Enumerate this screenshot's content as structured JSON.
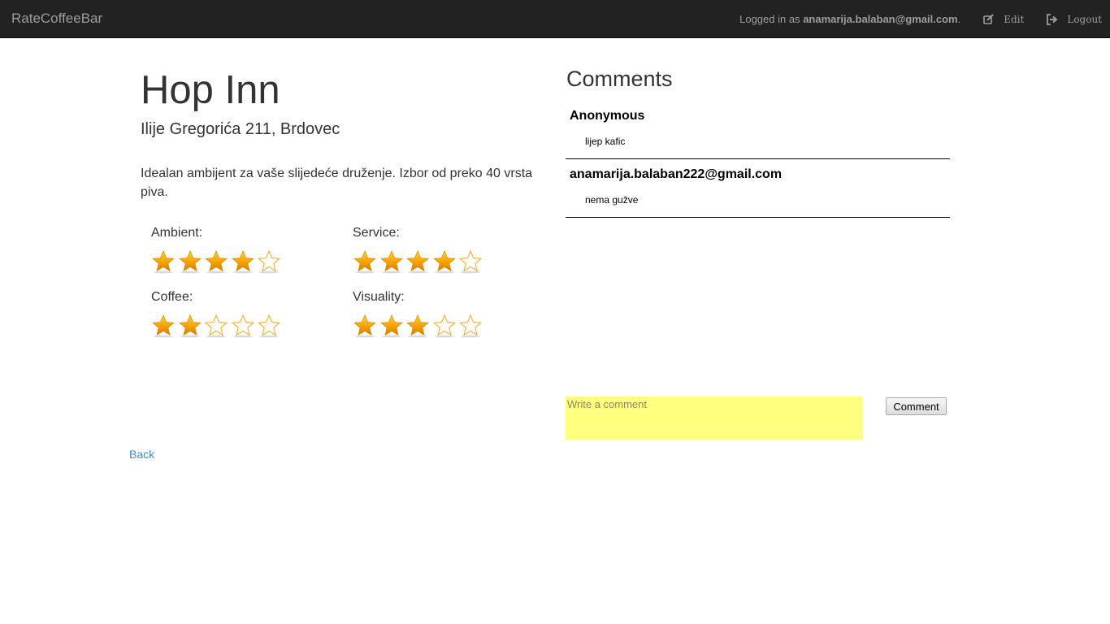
{
  "navbar": {
    "brand": "RateCoffeeBar",
    "logged_in_prefix": "Logged in as ",
    "user_email": "anamarija.balaban@gmail.com",
    "logged_in_suffix": ".",
    "edit_label": "Edit",
    "logout_label": "Logout"
  },
  "place": {
    "name": "Hop Inn",
    "address": "Ilije Gregorića 211, Brdovec",
    "description": "Idealan ambijent za vaše slijedeće druženje. Izbor od preko 40 vrsta piva."
  },
  "ratings": [
    {
      "label": "Ambient:",
      "value": 4,
      "max": 5
    },
    {
      "label": "Service:",
      "value": 4,
      "max": 5
    },
    {
      "label": "Coffee:",
      "value": 2,
      "max": 5
    },
    {
      "label": "Visuality:",
      "value": 3,
      "max": 5
    }
  ],
  "comments": {
    "title": "Comments",
    "items": [
      {
        "author": "Anonymous",
        "text": "lijep kafic"
      },
      {
        "author": "anamarija.balaban222@gmail.com",
        "text": "nema gužve"
      }
    ],
    "input_placeholder": "Write a comment",
    "submit_label": "Comment"
  },
  "back_label": "Back",
  "colors": {
    "navbar_bg": "#222222",
    "star_filled": "#f5a300",
    "star_empty_outline": "#f0b030",
    "comment_input_bg": "#ffff80",
    "link": "#428bca"
  }
}
